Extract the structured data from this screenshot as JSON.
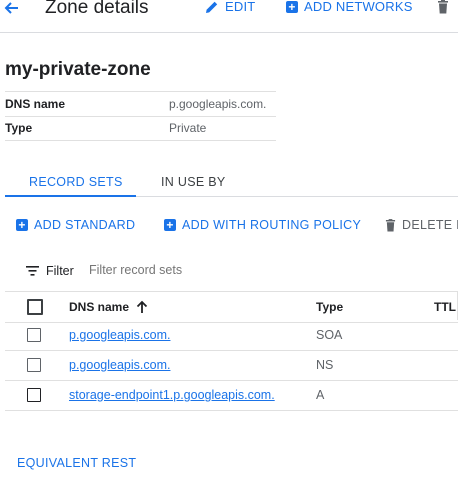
{
  "header": {
    "title": "Zone details",
    "actions": [
      {
        "label": "EDIT",
        "icon": "pencil-icon"
      },
      {
        "label": "ADD NETWORKS",
        "icon": "add-box-icon"
      },
      {
        "label": "",
        "icon": "delete-icon"
      }
    ]
  },
  "zone": {
    "name": "my-private-zone",
    "details": [
      {
        "key": "DNS name",
        "value": "p.googleapis.com."
      },
      {
        "key": "Type",
        "value": "Private"
      }
    ]
  },
  "tabs": [
    {
      "label": "RECORD SETS",
      "active": true
    },
    {
      "label": "IN USE BY",
      "active": false
    }
  ],
  "toolbar": {
    "add_standard": "ADD STANDARD",
    "add_routing": "ADD WITH ROUTING POLICY",
    "delete": "DELETE R"
  },
  "filter": {
    "label": "Filter",
    "placeholder": "Filter record sets"
  },
  "table": {
    "columns": [
      "DNS name",
      "Type",
      "TTL"
    ],
    "sort_icon": "arrow-up-icon",
    "rows": [
      {
        "dns_name": "p.googleapis.com.",
        "type": "SOA"
      },
      {
        "dns_name": "p.googleapis.com.",
        "type": "NS"
      },
      {
        "dns_name": "storage-endpoint1.p.googleapis.com.",
        "type": "A"
      }
    ]
  },
  "footer": {
    "equivalent_rest": "EQUIVALENT REST"
  },
  "colors": {
    "accent": "#1a73e8",
    "text": "#202124",
    "muted": "#5f6368",
    "divider": "#dadce0"
  }
}
